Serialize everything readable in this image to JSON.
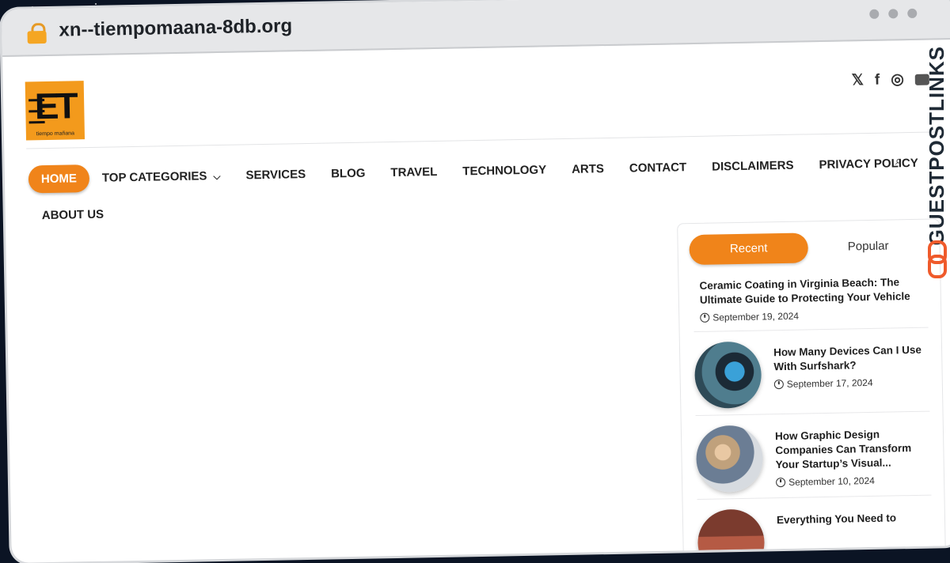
{
  "browser": {
    "url": "xn--tiempomaana-8db.org"
  },
  "site": {
    "logo_letters": "ET",
    "logo_tagline": "tiempo mañana"
  },
  "social": {
    "x_glyph": "𝕏",
    "facebook_glyph": "f",
    "instagram_glyph": "◎"
  },
  "nav": {
    "items": [
      "HOME",
      "TOP CATEGORIES",
      "SERVICES",
      "BLOG",
      "TRAVEL",
      "TECHNOLOGY",
      "ARTS",
      "CONTACT",
      "DISCLAIMERS",
      "PRIVACY POLICY",
      "ABOUT US"
    ]
  },
  "sidebar": {
    "tabs": [
      "Recent",
      "Popular"
    ],
    "posts": [
      {
        "title": "Ceramic Coating in Virginia Beach: The Ultimate Guide to Protecting Your Vehicle",
        "date": "September 19, 2024"
      },
      {
        "title": "How Many Devices Can I Use With Surfshark?",
        "date": "September 17, 2024"
      },
      {
        "title": "How Graphic Design Companies Can Transform Your Startup’s Visual...",
        "date": "September 10, 2024"
      },
      {
        "title": "Everything You Need to",
        "date": ""
      }
    ]
  },
  "watermark": {
    "text": "GUESTPOSTLINKS"
  },
  "icons": {
    "lock": "lock-icon",
    "search": "search-icon",
    "clock": "clock-icon",
    "chevron": "chevron-down-icon"
  },
  "colors": {
    "accent": "#f0841a",
    "brand_orange": "#ef5a2b"
  }
}
